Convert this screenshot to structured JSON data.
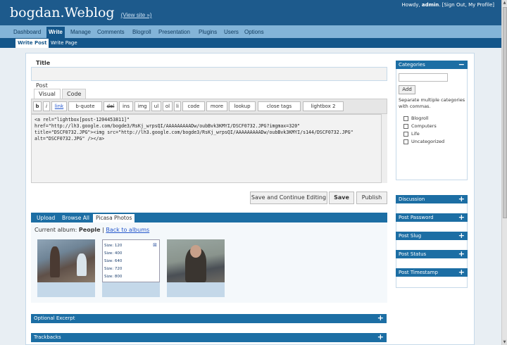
{
  "header": {
    "blog_name": "bogdan.Weblog",
    "view_site": "(View site »)",
    "howdy_prefix": "Howdy, ",
    "user": "admin",
    "howdy_suffix": ". [Sign Out, My Profile]"
  },
  "menu": [
    {
      "label": "Dashboard",
      "active": false
    },
    {
      "label": "Write",
      "active": true
    },
    {
      "label": "Manage",
      "active": false
    },
    {
      "label": "Comments",
      "active": false
    },
    {
      "label": "Blogroll",
      "active": false
    },
    {
      "label": "Presentation",
      "active": false
    },
    {
      "label": "Plugins",
      "active": false
    },
    {
      "label": "Users",
      "active": false
    },
    {
      "label": "Options",
      "active": false
    }
  ],
  "submenu": [
    {
      "label": "Write Post",
      "active": true
    },
    {
      "label": "Write Page",
      "active": false
    }
  ],
  "post": {
    "title_label": "Title",
    "title_value": "",
    "post_label": "Post",
    "tabs": [
      "Visual",
      "Code"
    ],
    "quicktags": [
      "b",
      "i",
      "link",
      "b-quote",
      "del",
      "ins",
      "img",
      "ul",
      "ol",
      "li",
      "code",
      "more",
      "lookup",
      "close tags",
      "lightbox 2"
    ],
    "content_lines": [
      "<a rel=\"lightbox[post-1204453811]\"",
      "href=\"http://lh3.google.com/bogde3/RsKj_wrpsQI/AAAAAAAAADw/oubBvk3KMYI/DSCF0732.JPG?imgmax=320\"",
      "title=\"DSCF0732.JPG\"><img src=\"http://lh3.google.com/bogde3/RsKj_wrpsQI/AAAAAAAAADw/oubBvk3KMYI/s144/DSCF0732.JPG\"",
      "alt=\"DSCF0732.JPG\" /></a>"
    ]
  },
  "actions": {
    "save_continue": "Save and Continue Editing",
    "save": "Save",
    "publish": "Publish"
  },
  "media": {
    "tabs": [
      "Upload",
      "Browse All",
      "Picasa Photos"
    ],
    "active_tab": "Picasa Photos",
    "album_label": "Current album:",
    "album_name": "People",
    "separator": "|",
    "back_link": "Back to albums",
    "sizes": [
      "Size: 120",
      "Size: 400",
      "Size: 640",
      "Size: 720",
      "Size: 800"
    ],
    "close_glyph": "⊠"
  },
  "bottom_boxes": [
    "Optional Excerpt",
    "Trackbacks"
  ],
  "sidebar": {
    "categories_title": "Categories",
    "add_button": "Add",
    "hint": "Separate multiple categories with commas.",
    "categories": [
      "Blogroll",
      "Computers",
      "Life",
      "Uncategorized"
    ],
    "boxes": [
      "Discussion",
      "Post Password",
      "Post Slug",
      "Post Status",
      "Post Timestamp"
    ]
  },
  "icons": {
    "expand": "+",
    "collapse": "−"
  },
  "colors": {
    "header": "#1d5a8c",
    "menu": "#83b4d8",
    "accent": "#1c6ea4"
  }
}
